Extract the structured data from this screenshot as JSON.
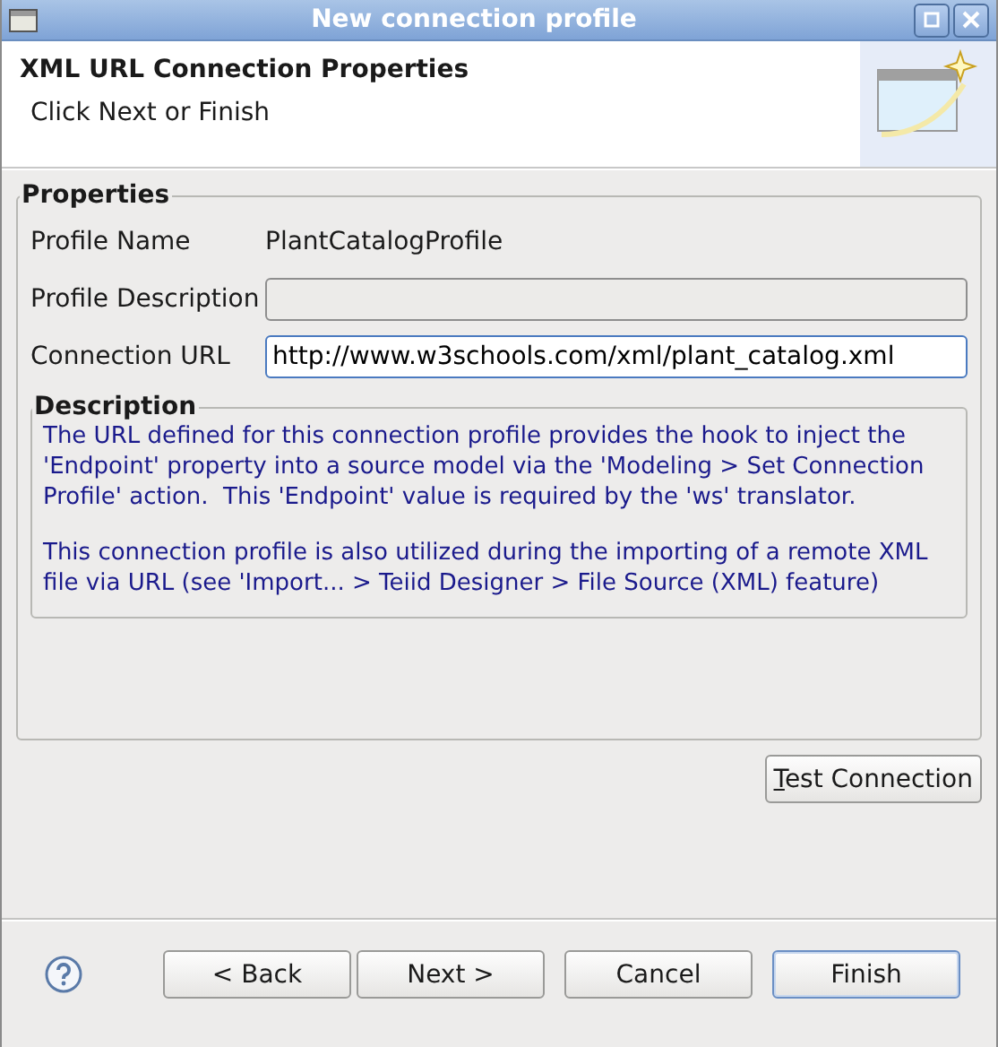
{
  "window": {
    "title": "New connection profile"
  },
  "header": {
    "title": "XML URL Connection Properties",
    "subtitle": "Click Next or Finish"
  },
  "properties": {
    "legend": "Properties",
    "fields": [
      {
        "kind": "static",
        "label": "Profile Name",
        "value": "PlantCatalogProfile"
      },
      {
        "kind": "input",
        "label": "Profile Description",
        "focused": false
      },
      {
        "kind": "input",
        "label": "Connection URL",
        "value": "http://www.w3schools.com/xml/plant_catalog.xml",
        "focused": true
      }
    ],
    "description": {
      "legend": "Description",
      "paragraphs": [
        "The URL defined for this connection profile provides the hook to inject the 'Endpoint' property into a source model via the 'Modeling > Set Connection Profile' action.  This 'Endpoint' value is required by the 'ws' translator.",
        "This connection profile is also utilized during the importing of a remote XML file via URL (see 'Import... > Teiid Designer > File Source (XML) feature)"
      ]
    }
  },
  "test_button": "Test Connection",
  "buttons": [
    {
      "label": "< Back",
      "default": false
    },
    {
      "label": "Next >",
      "default": false
    },
    {
      "label": "Cancel",
      "default": false
    },
    {
      "label": "Finish",
      "default": true
    }
  ]
}
